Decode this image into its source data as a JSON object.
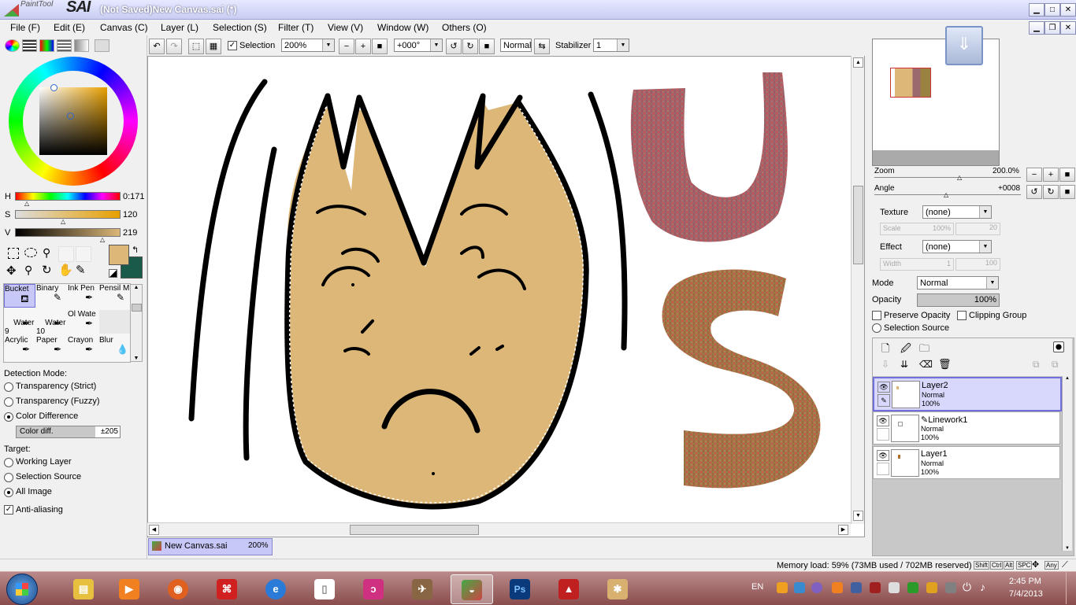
{
  "window": {
    "app_logo_small": "PaintTool",
    "app_logo_big": "SAI",
    "title": "(Not Saved)New Canvas.sai (*)"
  },
  "menu": [
    "File (F)",
    "Edit (E)",
    "Canvas (C)",
    "Layer (L)",
    "Selection (S)",
    "Filter (T)",
    "View (V)",
    "Window (W)",
    "Others (O)"
  ],
  "color": {
    "h_label": "H",
    "h_value": "0:171",
    "s_label": "S",
    "s_value": "120",
    "v_label": "V",
    "v_value": "219",
    "primary": "#dcb778",
    "secondary": "#1a5a4a"
  },
  "tools": [
    {
      "label": "Bucket",
      "selected": true
    },
    {
      "label": "Binary"
    },
    {
      "label": "Ink Pen"
    },
    {
      "label": "Pensil M"
    },
    {
      "label": "Water\n9"
    },
    {
      "label": "Water\n10"
    },
    {
      "label": "Ol Wate"
    },
    {
      "label": ""
    },
    {
      "label": "Acrylic"
    },
    {
      "label": "Paper"
    },
    {
      "label": "Crayon"
    },
    {
      "label": "Blur"
    }
  ],
  "bucket": {
    "detection_mode_label": "Detection Mode:",
    "mode_strict": "Transparency (Strict)",
    "mode_fuzzy": "Transparency (Fuzzy)",
    "mode_color_diff": "Color Difference",
    "color_diff_label": "Color diff.",
    "color_diff_value": "±205",
    "target_label": "Target:",
    "target_working": "Working Layer",
    "target_selection": "Selection Source",
    "target_all": "All Image",
    "antialiasing": "Anti-aliasing"
  },
  "toolbar": {
    "selection_label": "Selection",
    "zoom_value": "200%",
    "rotation_value": "+000°",
    "blend_value": "Normal",
    "stabilizer_label": "Stabilizer",
    "stabilizer_value": "1"
  },
  "document_tab": {
    "name": "New Canvas.sai",
    "zoom": "200%"
  },
  "navigator": {
    "zoom_label": "Zoom",
    "zoom_value": "200.0%",
    "angle_label": "Angle",
    "angle_value": "+0008"
  },
  "layer_props": {
    "texture_label": "Texture",
    "texture_value": "(none)",
    "scale_label": "Scale",
    "scale_value": "100%",
    "scale_value2": "20",
    "effect_label": "Effect",
    "effect_value": "(none)",
    "width_label": "Width",
    "width_value": "1",
    "width_value2": "100",
    "mode_label": "Mode",
    "mode_value": "Normal",
    "opacity_label": "Opacity",
    "opacity_value": "100%",
    "preserve_opacity": "Preserve Opacity",
    "clipping_group": "Clipping Group",
    "selection_source": "Selection Source"
  },
  "layers": [
    {
      "name": "Layer2",
      "mode": "Normal",
      "opacity": "100%",
      "selected": true
    },
    {
      "name": "Linework1",
      "mode": "Normal",
      "opacity": "100%"
    },
    {
      "name": "Layer1",
      "mode": "Normal",
      "opacity": "100%"
    }
  ],
  "status": {
    "memory": "Memory load: 59% (73MB used / 702MB reserved)",
    "keys": [
      "Shift",
      "Ctrl",
      "Alt",
      "SPC",
      "Any"
    ]
  },
  "taskbar": {
    "language": "EN",
    "time": "2:45 PM",
    "date": "7/4/2013"
  }
}
